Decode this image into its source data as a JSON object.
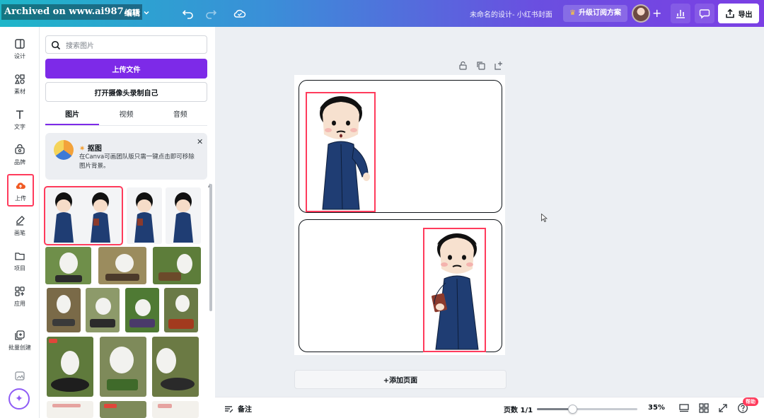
{
  "watermark": "Archived on www.ai987.cn",
  "topbar": {
    "edit_label": "编辑",
    "design_title": "未命名的设计- 小红书封面",
    "upgrade_label": "升级订阅方案",
    "export_label": "导出",
    "icons": [
      "pencil-icon",
      "chevron-down-icon",
      "undo-icon",
      "redo-icon",
      "cloud-sync-icon",
      "crown-icon",
      "plus-icon",
      "chart-icon",
      "comment-icon",
      "share-upload-icon"
    ]
  },
  "rail": {
    "items": [
      {
        "label": "设计",
        "icon": "layout-icon"
      },
      {
        "label": "素材",
        "icon": "elements-icon"
      },
      {
        "label": "文字",
        "icon": "text-icon"
      },
      {
        "label": "品牌",
        "icon": "brand-icon"
      },
      {
        "label": "上传",
        "icon": "upload-cloud-icon",
        "active": true
      },
      {
        "label": "画笔",
        "icon": "brush-icon"
      },
      {
        "label": "项目",
        "icon": "folder-icon"
      },
      {
        "label": "应用",
        "icon": "apps-icon"
      },
      {
        "label": "批量创建",
        "icon": "bulk-create-icon"
      }
    ]
  },
  "panel": {
    "search_placeholder": "搜索图片",
    "upload_button": "上传文件",
    "camera_button": "打开摄像头录制自己",
    "tabs": [
      "图片",
      "视频",
      "音频"
    ],
    "active_tab": "图片",
    "promo": {
      "title": "抠图",
      "text": "在Canva可画团队版只需一键点击即可移除图片背景。"
    }
  },
  "canvas": {
    "add_page_label": "+添加页面"
  },
  "bottom": {
    "notes_label": "备注",
    "pages_label": "页数 1/1",
    "zoom_label": "35%",
    "zoom_fraction": 0.35,
    "help_label": "帮助"
  },
  "colors": {
    "accent": "#7d2ae8",
    "selection": "#ff3b5c",
    "robe": "#1f3d73"
  }
}
